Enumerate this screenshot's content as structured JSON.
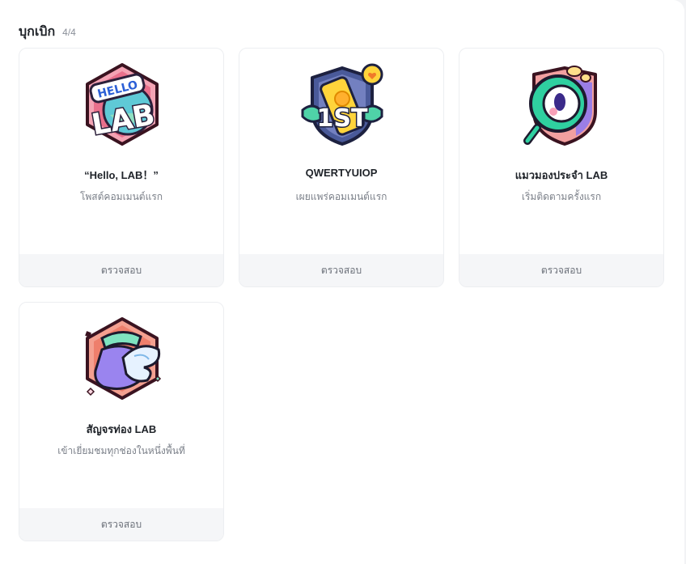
{
  "section": {
    "title": "บุกเบิก",
    "count": "4/4"
  },
  "badges": [
    {
      "title": "“Hello, LAB！”",
      "description": "โพสต์คอมเมนต์แรก",
      "action": "ตรวจสอบ",
      "icon": "hello-lab-badge-icon",
      "logo_text_top": "HELLO",
      "logo_text_main": "LAB"
    },
    {
      "title": "QWERTYUIOP",
      "description": "เผยแพร่คอมเมนต์แรก",
      "action": "ตรวจสอบ",
      "icon": "first-badge-icon",
      "logo_text_main": "1ST"
    },
    {
      "title": "แมวมองประจำ LAB",
      "description": "เริ่มติดตามครั้งแรก",
      "action": "ตรวจสอบ",
      "icon": "magnifier-eye-badge-icon"
    },
    {
      "title": "สัญจรท่อง LAB",
      "description": "เข้าเยี่ยมชมทุกช่องในหนึ่งพื้นที่",
      "action": "ตรวจสอบ",
      "icon": "winged-shoe-badge-icon"
    }
  ]
}
